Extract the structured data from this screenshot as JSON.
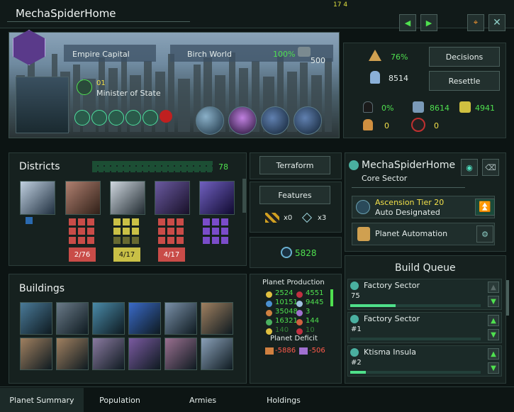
{
  "window": {
    "title": "MechaSpiderHome",
    "top_badge": "17 4"
  },
  "header": {
    "capital_label": "Empire Capital",
    "planet_type": "Birch World",
    "habitability": "100%",
    "pop_cap": "500",
    "leader_level": "01",
    "leader_title": "Minister of State"
  },
  "stats": {
    "stability": "76%",
    "population": "8514",
    "decisions_label": "Decisions",
    "resettle_label": "Resettle",
    "crime": "0%",
    "amenities": "8614",
    "amenities_extra": "4941",
    "unemployed": "0",
    "free_housing": "0"
  },
  "districts": {
    "title": "Districts",
    "count": "78",
    "terraform_label": "Terraform",
    "features_label": "Features",
    "feature1_count": "x0",
    "feature2_count": "x3",
    "energy": "5828",
    "items": [
      {
        "name": "district-city",
        "label": ""
      },
      {
        "name": "district-industrial",
        "label": "2/76",
        "color": "#c94c48"
      },
      {
        "name": "district-generator",
        "label": "4/17",
        "color": "#c9c046"
      },
      {
        "name": "district-mining",
        "label": "4/17",
        "color": "#c94c48"
      },
      {
        "name": "district-research",
        "label": "",
        "color": "#7a4cc9"
      }
    ]
  },
  "sector": {
    "name": "MechaSpiderHome",
    "type": "Core Sector",
    "ascension": "Ascension Tier 20",
    "designation": "Auto Designated",
    "automation_label": "Planet Automation"
  },
  "buildings": {
    "title": "Buildings"
  },
  "production": {
    "title": "Planet Production",
    "rows": [
      [
        "2524",
        "4551"
      ],
      [
        "10151",
        "9445"
      ],
      [
        "35048",
        "3"
      ],
      [
        "16321",
        "144"
      ],
      [
        "140",
        "10"
      ]
    ],
    "deficit_title": "Planet Deficit",
    "deficit": [
      "-5886",
      "-506"
    ]
  },
  "queue": {
    "title": "Build Queue",
    "items": [
      {
        "name": "Factory Sector",
        "sub": "75",
        "progress": 0.35
      },
      {
        "name": "Factory Sector",
        "sub": "#1",
        "progress": 0
      },
      {
        "name": "Ktisma Insula",
        "sub": "#2",
        "progress": 0.12
      }
    ]
  },
  "tabs": [
    "Planet Summary",
    "Population",
    "Armies",
    "Holdings"
  ],
  "colors": {
    "accent": "#4fe04f",
    "panel": "#16211f",
    "border": "#2b3c39"
  }
}
